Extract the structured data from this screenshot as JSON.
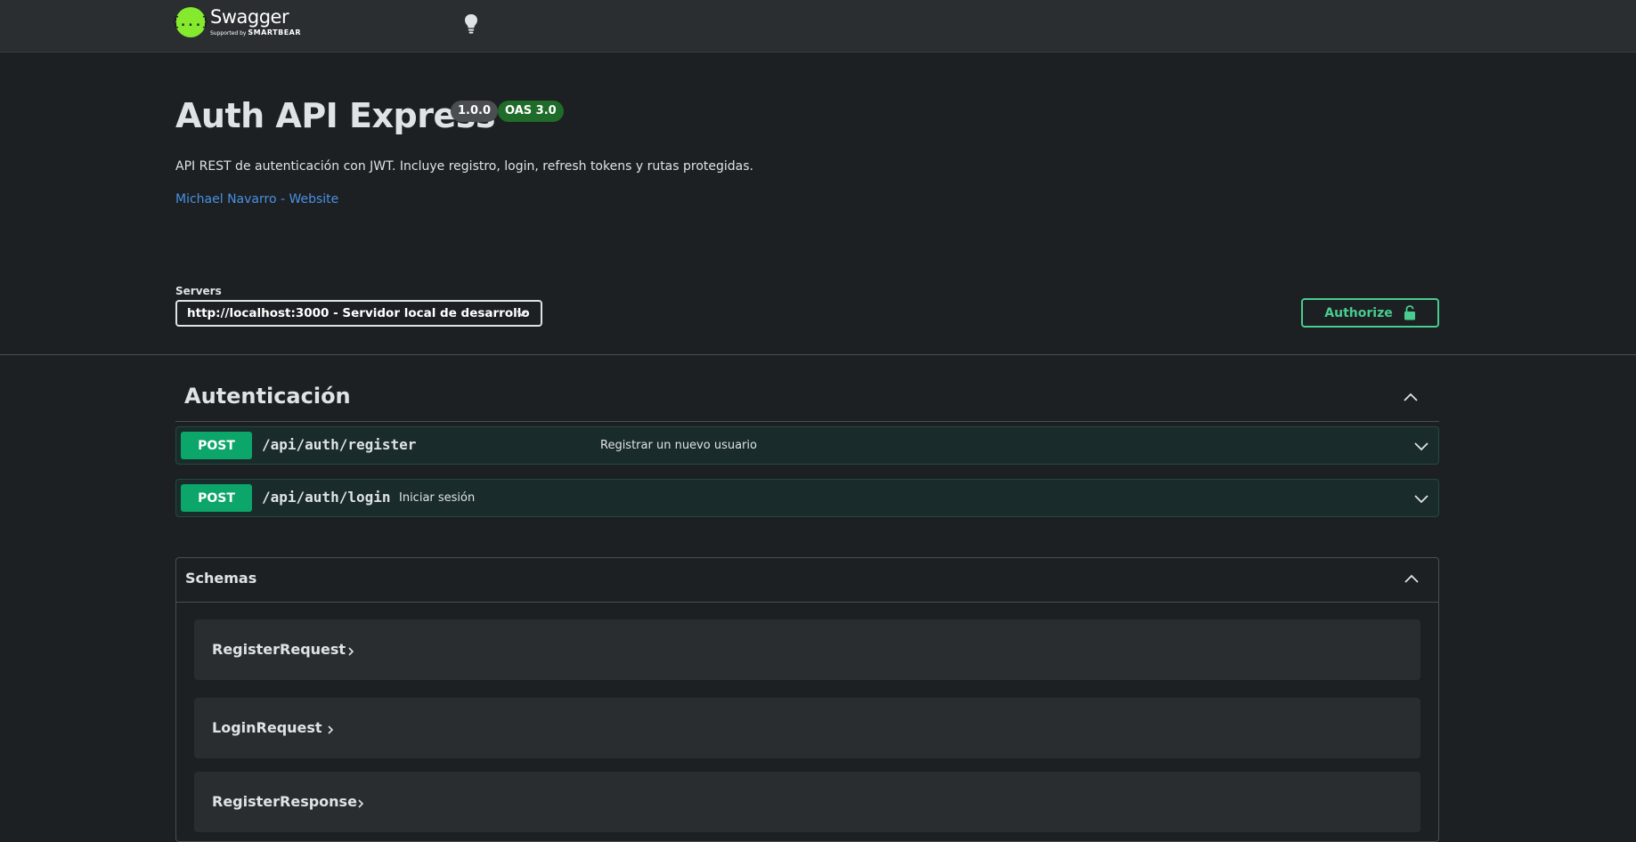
{
  "header": {
    "logo_symbol": "{...}",
    "logo_name": "Swagger",
    "logo_sub_prefix": "Supported by",
    "logo_sub_brand": "SMARTBEAR",
    "theme_icon": "lightbulb-icon"
  },
  "info": {
    "title": "Auth API Express",
    "version": "1.0.0",
    "oas": "OAS 3.0",
    "description": "API REST de autenticación con JWT. Incluye registro, login, refresh tokens y rutas protegidas.",
    "contact_link": "Michael Navarro - Website"
  },
  "servers": {
    "label": "Servers",
    "selected": "http://localhost:3000 - Servidor local de desarrollo"
  },
  "authorize": {
    "label": "Authorize",
    "icon": "unlock-icon"
  },
  "tag": {
    "name": "Autenticación",
    "operations": [
      {
        "method": "POST",
        "path": "/api/auth/register",
        "summary": "Registrar un nuevo usuario"
      },
      {
        "method": "POST",
        "path": "/api/auth/login",
        "summary": "Iniciar sesión"
      }
    ]
  },
  "schemas": {
    "title": "Schemas",
    "models": [
      "RegisterRequest",
      "LoginRequest",
      "RegisterResponse"
    ]
  },
  "colors": {
    "background": "#1c2022",
    "topbar": "#2a2e30",
    "accent_green": "#49cc90",
    "post_method": "#0ca56a",
    "link": "#4990e2"
  }
}
